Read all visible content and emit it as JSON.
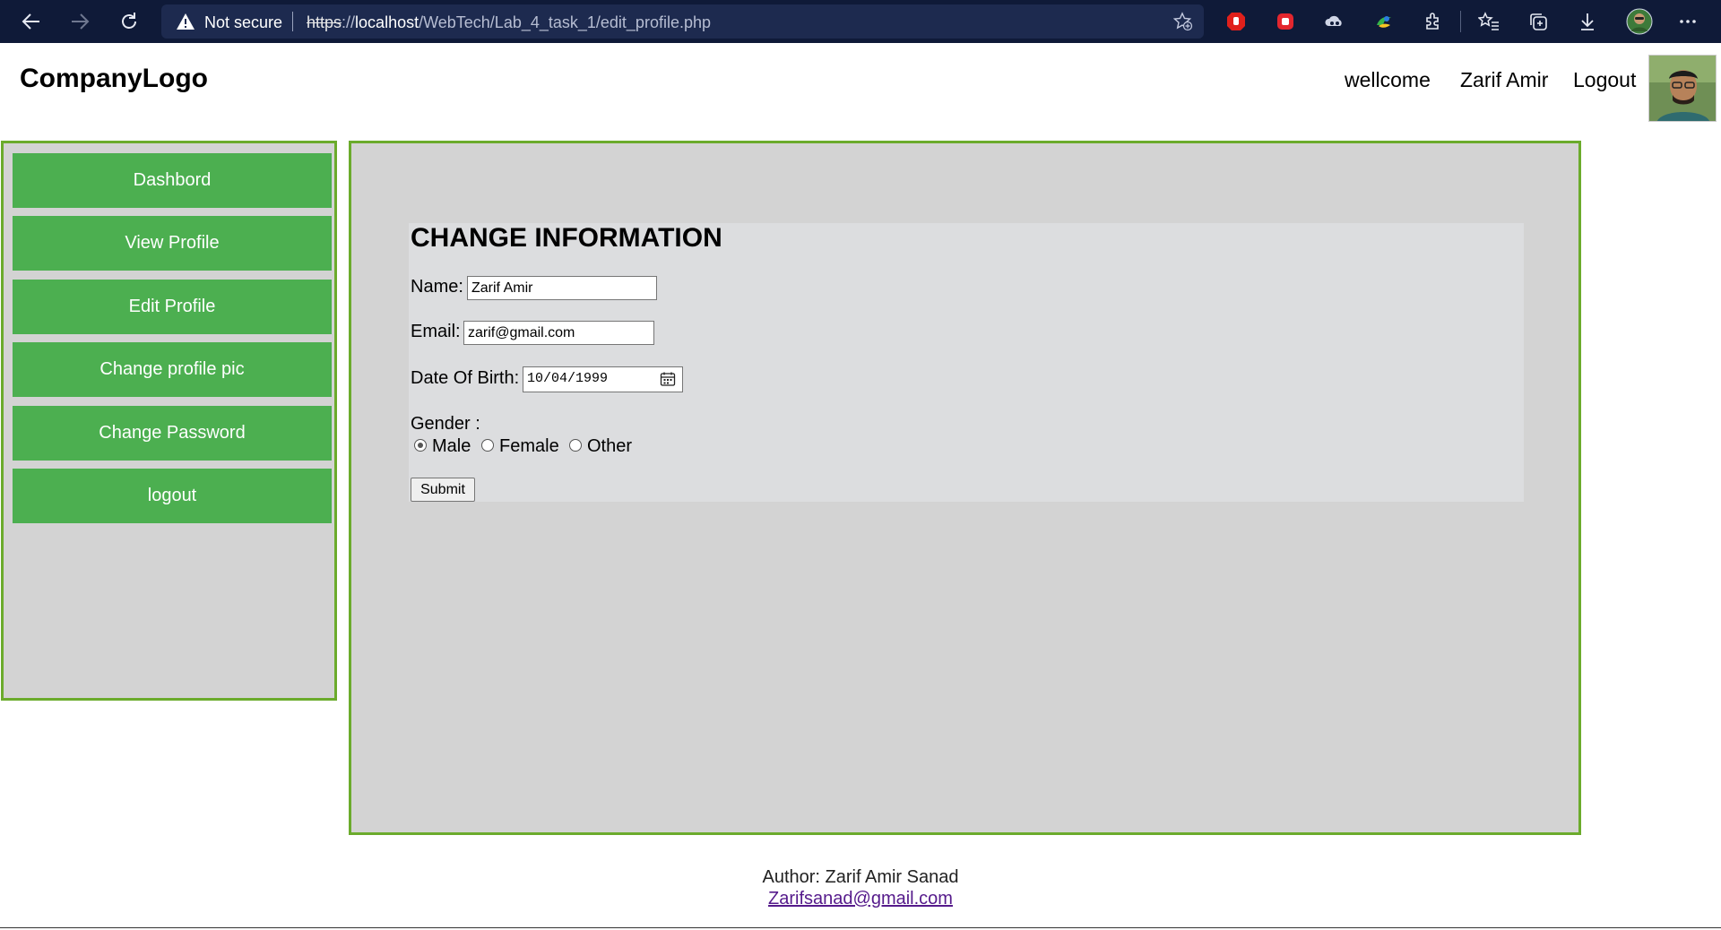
{
  "browser": {
    "security_label": "Not secure",
    "url_scheme": "https",
    "url_sep": "://",
    "url_host": "localhost",
    "url_path": "/WebTech/Lab_4_task_1/edit_profile.php",
    "icons": [
      "back-icon",
      "forward-icon",
      "refresh-icon",
      "warning-icon",
      "favorite-add-icon",
      "extension-red-hand-icon",
      "extension-red-square-icon",
      "extension-cloud-icon",
      "extension-colorful-icon",
      "extensions-puzzle-icon",
      "favorites-icon",
      "collections-icon",
      "download-icon",
      "profile-icon",
      "more-icon"
    ]
  },
  "header": {
    "logo": "CompanyLogo",
    "welcome": "wellcome",
    "user_name": "Zarif Amir",
    "logout": "Logout"
  },
  "sidebar": {
    "items": [
      {
        "label": "Dashbord"
      },
      {
        "label": "View Profile"
      },
      {
        "label": "Edit Profile"
      },
      {
        "label": "Change profile pic"
      },
      {
        "label": "Change Password"
      },
      {
        "label": "logout"
      }
    ]
  },
  "form": {
    "title": "CHANGE INFORMATION",
    "name_label": "Name:",
    "name_value": "Zarif Amir",
    "email_label": "Email:",
    "email_value": "zarif@gmail.com",
    "dob_label": "Date Of Birth:",
    "dob_value": "10/04/1999",
    "gender_label": "Gender :",
    "gender_options": [
      {
        "label": "Male",
        "checked": true
      },
      {
        "label": "Female",
        "checked": false
      },
      {
        "label": "Other",
        "checked": false
      }
    ],
    "submit_label": "Submit"
  },
  "footer": {
    "author": "Author: Zarif Amir Sanad",
    "email": "Zarifsanad@gmail.com"
  },
  "colors": {
    "sidebar_button": "#4caf50",
    "panel_border": "#6bab2c",
    "panel_background": "#d3d3d3",
    "browser_bar": "#0f1a38"
  }
}
